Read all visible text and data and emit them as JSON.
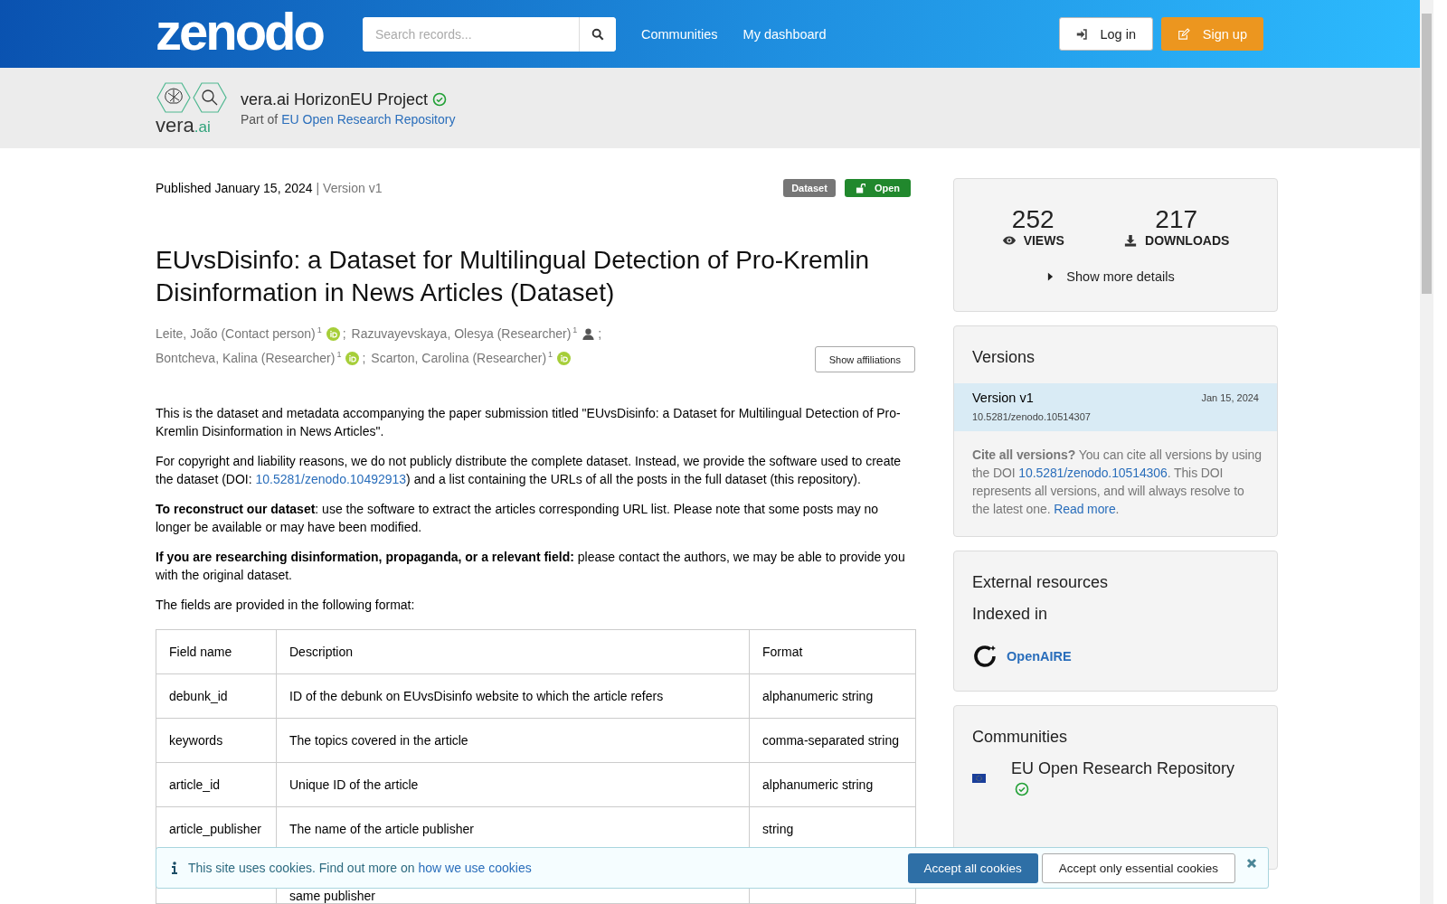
{
  "header": {
    "logo": "zenodo",
    "search": {
      "placeholder": "Search records..."
    },
    "nav": [
      "Communities",
      "My dashboard"
    ],
    "buttons": [
      {
        "kind": "login",
        "label": "Log in"
      },
      {
        "kind": "signup",
        "label": "Sign up"
      }
    ]
  },
  "community": {
    "logo_text": "vera",
    "logo_accent": ".ai",
    "name": "vera.ai HorizonEU Project",
    "verified": true,
    "parent_prefix": "Part of",
    "parent": "EU Open Research Repository"
  },
  "record": {
    "published": "Published January 15, 2024",
    "version": "| Version v1",
    "badges": [
      {
        "kind": "type",
        "label": "Dataset"
      },
      {
        "kind": "access",
        "label": "Open"
      }
    ],
    "title": "EUvsDisinfo: a Dataset for Multilingual Detection of Pro-Kremlin Disinformation in News Articles (Dataset)",
    "creators": [
      {
        "name": "Leite, João (Contact person)",
        "affiliation": "1",
        "kind": "orcid",
        "separator": ";"
      },
      {
        "name": "Razuvayevskaya, Olesya (Researcher)",
        "affiliation": "1",
        "kind": "person",
        "separator": ";"
      },
      {
        "name": "Bontcheva, Kalina (Researcher)",
        "affiliation": "1",
        "kind": "orcid",
        "separator": ";"
      },
      {
        "name": "Scarton, Carolina (Researcher)",
        "affiliation": "1",
        "kind": "orcid"
      }
    ],
    "affiliations_button": "Show affiliations",
    "description": [
      [
        {
          "text": "This is the dataset and metadata accompanying the paper submission titled \"EUvsDisinfo: a Dataset for Multilingual Detection of Pro-Kremlin Disinformation in News Articles\"."
        }
      ],
      [
        {
          "text": "For copyright and liability reasons, we do not publicly distribute the complete dataset. Instead, we provide the software used to create the dataset (DOI: "
        },
        {
          "link": "10.5281/zenodo.10492913"
        },
        {
          "text": ") and a list containing the URLs of all the posts in the full dataset (this repository)."
        }
      ],
      [
        {
          "text": "**To reconstruct our dataset**: use the software to extract the articles corresponding URL list. Please note that some posts may no longer be available or may have been modified."
        }
      ],
      [
        {
          "text": "**If you are researching disinformation, propaganda, or a relevant field:** please contact the authors, we may be able to provide you with the original dataset."
        }
      ],
      [
        {
          "text": "The fields are provided in the following format:"
        }
      ]
    ],
    "table": {
      "columns": [
        "Field name",
        "Description",
        "Format"
      ],
      "rows": [
        [
          "debunk_id",
          "ID of the debunk on EUvsDisinfo website to which the article refers",
          "alphanumeric string"
        ],
        [
          "keywords",
          "The topics covered in the article",
          "comma-separated string"
        ],
        [
          "article_id",
          "Unique ID of the article",
          "alphanumeric string"
        ],
        [
          "article_publisher",
          "The name of the article publisher",
          "string"
        ]
      ],
      "partial_row": {
        "description": "same publisher"
      }
    }
  },
  "sidebar": {
    "stats": [
      {
        "kind": "views",
        "value": "252",
        "label": "VIEWS"
      },
      {
        "kind": "downloads",
        "value": "217",
        "label": "DOWNLOADS"
      }
    ],
    "details_toggle": {
      "label": "Show more details",
      "expanded": false
    },
    "versions": {
      "title": "Versions",
      "items": [
        {
          "label": "Version v1",
          "date": "Jan 15, 2024",
          "doi": "10.5281/zenodo.10514307",
          "selected": true
        }
      ],
      "cite": [
        {
          "text": "**Cite all versions?** You can cite all versions by using the DOI "
        },
        {
          "link": "10.5281/zenodo.10514306"
        },
        {
          "text": ". This DOI represents all versions, and will always resolve to the latest one. "
        },
        {
          "link": "Read more"
        },
        {
          "text": "."
        }
      ]
    },
    "external": {
      "title": "External resources",
      "subtitle": "Indexed in",
      "items": [
        {
          "name": "OpenAIRE"
        }
      ]
    },
    "communities": {
      "title": "Communities",
      "items": [
        {
          "name": "EU Open Research Repository",
          "verified": true
        }
      ]
    }
  },
  "cookie_banner": {
    "message": [
      {
        "text": "This site uses cookies. Find out more on "
      },
      {
        "link": "how we use cookies"
      }
    ],
    "buttons": [
      {
        "kind": "primary",
        "label": "Accept all cookies"
      },
      {
        "kind": "secondary",
        "label": "Accept only essential cookies"
      }
    ]
  }
}
